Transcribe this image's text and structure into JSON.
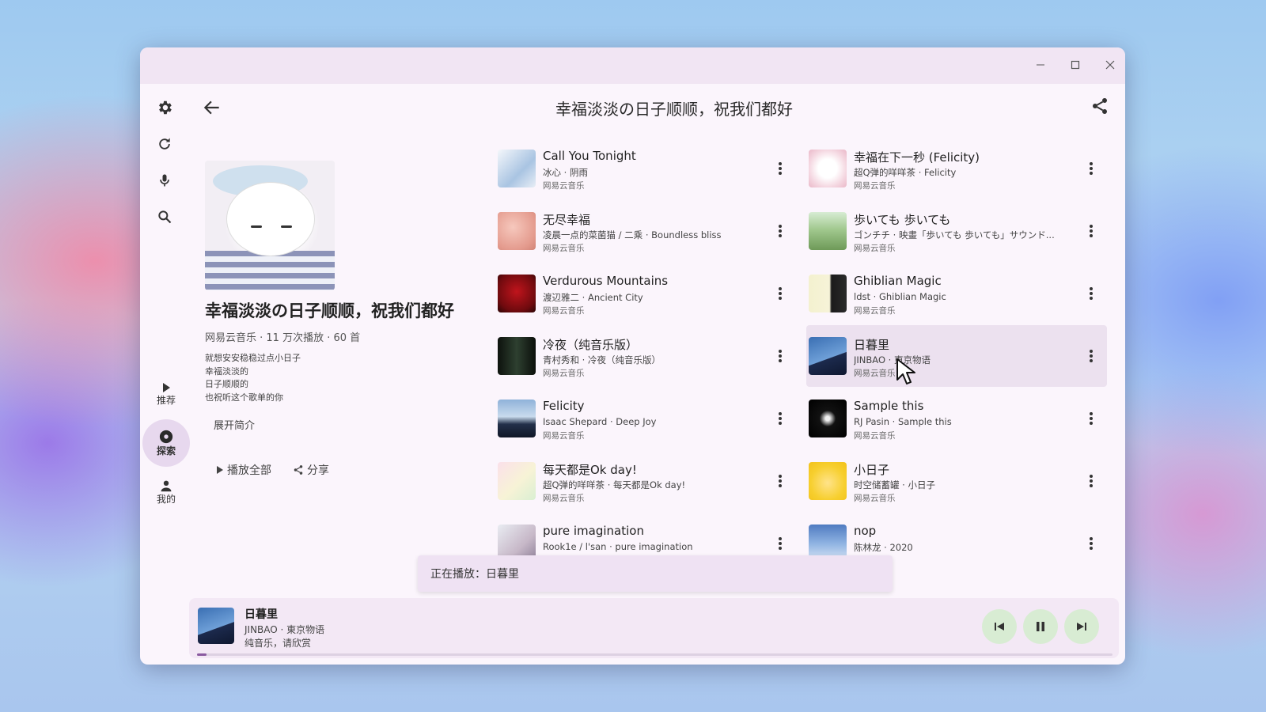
{
  "window": {
    "minimize_icon": "minimize-icon",
    "maximize_icon": "maximize-icon",
    "close_icon": "close-icon"
  },
  "rail": {
    "icons": [
      "gear-icon",
      "refresh-icon",
      "microphone-icon",
      "search-icon"
    ],
    "nav": [
      {
        "label": "推荐",
        "icon": "play-icon"
      },
      {
        "label": "探索",
        "icon": "disc-icon",
        "active": true
      },
      {
        "label": "我的",
        "icon": "person-icon"
      }
    ]
  },
  "header": {
    "title": "幸福淡淡の日子顺顺，祝我们都好",
    "back_icon": "arrow-left-icon",
    "share_icon": "share-icon"
  },
  "playlist": {
    "name": "幸福淡淡の日子顺顺，祝我们都好",
    "meta": "网易云音乐 · 11 万次播放 · 60 首",
    "description": [
      "就想安安稳稳过点小日子",
      "幸福淡淡的",
      "日子顺顺的",
      "也祝听这个歌单的你"
    ],
    "expand_label": "展开简介",
    "play_all_label": "播放全部",
    "share_label": "分享"
  },
  "songs_left": [
    {
      "title": "Call You Tonight",
      "sub": "冰心 · 阴雨",
      "source": "网易云音乐"
    },
    {
      "title": "无尽幸福",
      "sub": "凌晨一点的菜菌猫 / 二乘 · Boundless bliss",
      "source": "网易云音乐"
    },
    {
      "title": "Verdurous Mountains",
      "sub": "渡辺雅二 · Ancient City",
      "source": "网易云音乐"
    },
    {
      "title": "冷夜（纯音乐版）",
      "sub": "青村秀和 · 冷夜（纯音乐版）",
      "source": "网易云音乐"
    },
    {
      "title": "Felicity",
      "sub": "Isaac Shepard · Deep Joy",
      "source": "网易云音乐"
    },
    {
      "title": "每天都是Ok day!",
      "sub": "超Q弹的咩咩茶 · 每天都是Ok day!",
      "source": "网易云音乐"
    },
    {
      "title": "pure imagination",
      "sub": "Rook1e / l'san · pure imagination",
      "source": ""
    }
  ],
  "songs_right": [
    {
      "title": "幸福在下一秒 (Felicity)",
      "sub": "超Q弹的咩咩茶 · Felicity",
      "source": "网易云音乐"
    },
    {
      "title": "歩いても 歩いても",
      "sub": "ゴンチチ · 映畫「歩いても 歩いても」サウンド...",
      "source": "网易云音乐"
    },
    {
      "title": "Ghiblian Magic",
      "sub": "ldst · Ghiblian Magic",
      "source": "网易云音乐"
    },
    {
      "title": "日暮里",
      "sub": "JINBAO · 東京物语",
      "source": "网易云音乐",
      "highlighted": true
    },
    {
      "title": "Sample this",
      "sub": "RJ Pasin · Sample this",
      "source": "网易云音乐"
    },
    {
      "title": "小日子",
      "sub": "时空储蓄罐 · 小日子",
      "source": "网易云音乐"
    },
    {
      "title": "nop",
      "sub": "陈林龙 · 2020",
      "source": ""
    }
  ],
  "toast": {
    "text": "正在播放：日暮里"
  },
  "player": {
    "title": "日暮里",
    "artist_album": "JINBAO · 東京物语",
    "extra": "纯音乐，请欣赏",
    "progress": 0.01,
    "controls": [
      "skip-previous-icon",
      "pause-icon",
      "skip-next-icon"
    ]
  },
  "colors": {
    "accent": "#8a5aa0",
    "surface": "#fbf5fc",
    "titlebar": "#f1e5f3",
    "control_bg": "#d8ecd3"
  }
}
